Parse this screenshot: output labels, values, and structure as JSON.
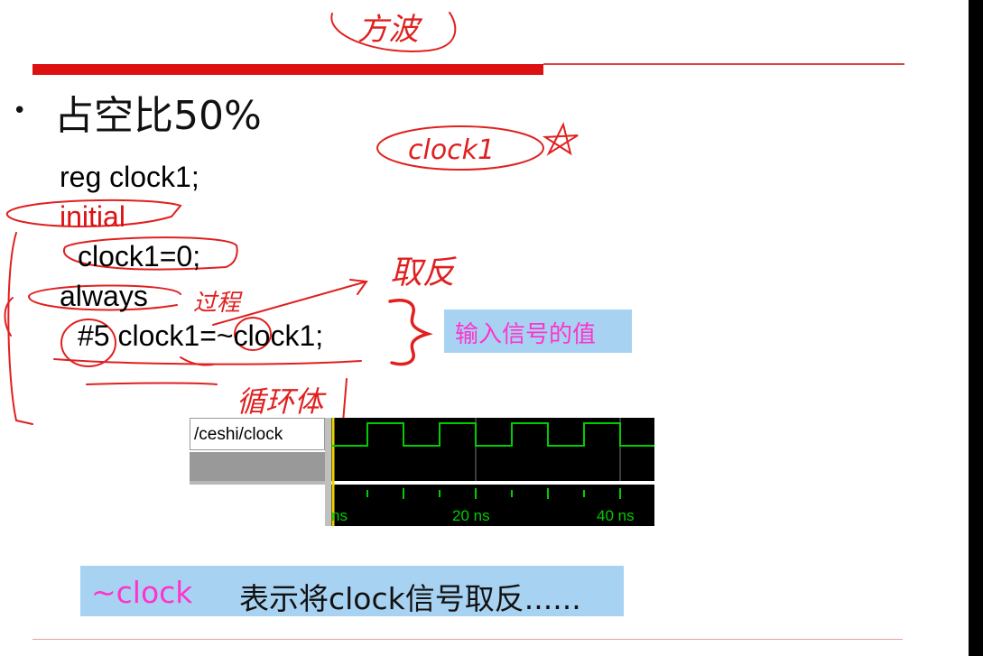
{
  "handwriting": {
    "title": "方波",
    "clock_note": "clock1",
    "invert_note": "取反",
    "process_note": "过程",
    "loop_note": "循环体"
  },
  "bullet": {
    "text": "占空比50%"
  },
  "code": {
    "line1": "reg clock1;",
    "line2": "initial",
    "line3": "clock1=0;",
    "line4": "always",
    "line5": "#5 clock1=~clock1;"
  },
  "callout": {
    "text": "输入信号的值"
  },
  "waveform": {
    "signal": "/ceshi/clock",
    "tick_start": "ns",
    "tick_20": "20 ns",
    "tick_40": "40 ns"
  },
  "note": {
    "op": "~clock",
    "desc": "表示将clock信号取反......"
  },
  "colors": {
    "accent_red": "#dd1111",
    "wave_green": "#00cc00",
    "callout_text": "#ff33cc",
    "box_blue": "#a8d2f2"
  }
}
